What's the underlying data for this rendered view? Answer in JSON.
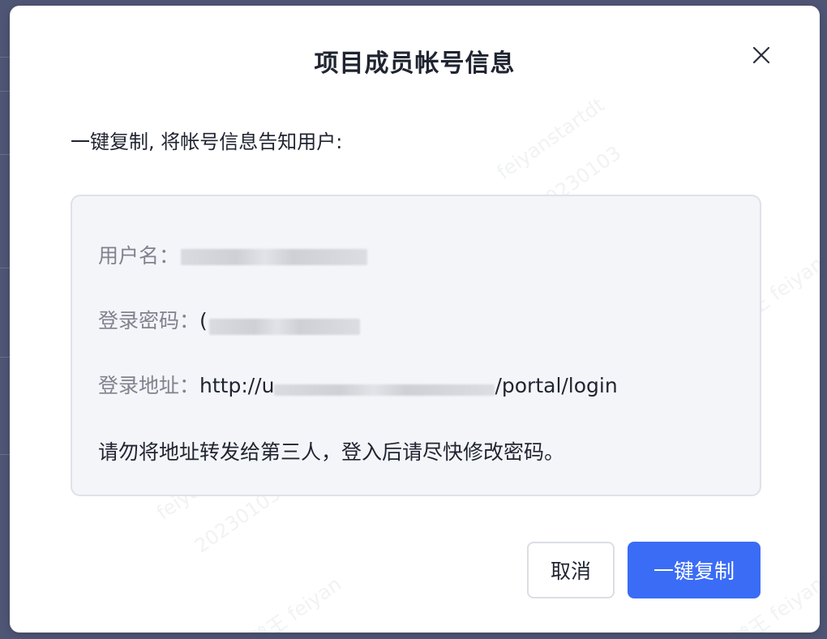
{
  "dialog": {
    "title": "项目成员帐号信息",
    "intro": "一键复制, 将帐号信息告知用户:",
    "fields": {
      "username_label": "用户名：",
      "password_label": "登录密码：",
      "password_prefix": "(",
      "address_label": "登录地址：",
      "address_prefix": "http://u",
      "address_suffix": "/portal/login"
    },
    "notice": "请勿将地址转发给第三人，登入后请尽快修改密码。",
    "cancel_label": "取消",
    "copy_label": "一键复制"
  },
  "watermarks": [
    "feiyanstartdt",
    "20230103",
    "企鹅王 feiyan",
    "企鹅王 feiyan",
    "feiyanstartdt",
    "20230103",
    "企鹅王 feiyan",
    "企鹅王 feiyan"
  ],
  "colors": {
    "primary": "#3b6cf6",
    "overlay": "#4f5575",
    "info_bg": "#f4f5f9"
  }
}
